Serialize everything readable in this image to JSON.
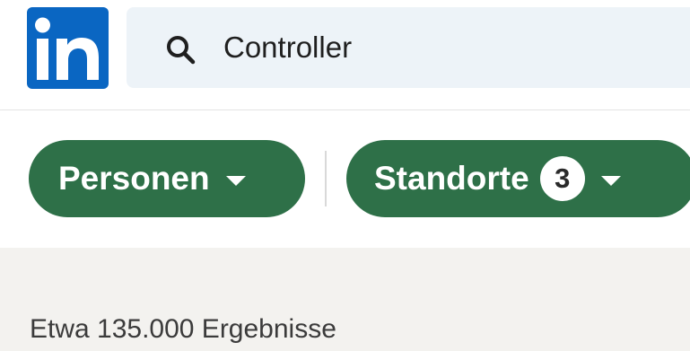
{
  "brand": {
    "logo_text": "in",
    "logo_color": "#0a66c2"
  },
  "search": {
    "icon": "search-icon",
    "value": "Controller"
  },
  "filters": {
    "personen": {
      "label": "Personen",
      "icon": "caret-down-icon"
    },
    "standorte": {
      "label": "Standorte",
      "count": "3",
      "icon": "caret-down-icon"
    },
    "pill_color": "#2e7048"
  },
  "results": {
    "count_text": "Etwa 135.000 Ergebnisse"
  }
}
